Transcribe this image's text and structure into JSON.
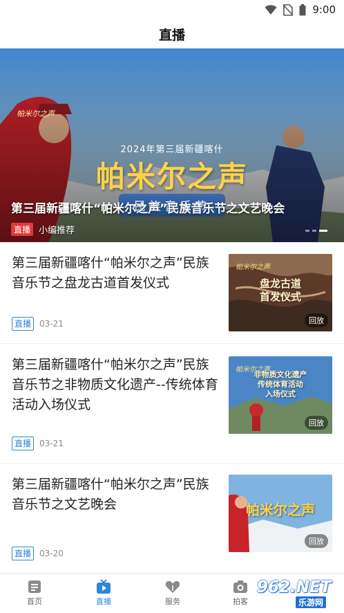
{
  "status_bar": {
    "time": "9:00"
  },
  "header": {
    "title": "直播"
  },
  "banner": {
    "top_line": "2024年第三届新疆喀什",
    "main_title": "帕米尔之声",
    "subtitle": "民族音乐节",
    "title": "第三届新疆喀什“帕米尔之声”民族音乐节之文艺晚会",
    "tag": "直播",
    "recommend": "小编推荐"
  },
  "items": [
    {
      "title": "第三届新疆喀什“帕米尔之声”民族音乐节之盘龙古道首发仪式",
      "tag": "直播",
      "date": "03-21",
      "thumb_title": "盘龙古道\n首发仪式",
      "replay": "回放"
    },
    {
      "title": "第三届新疆喀什“帕米尔之声”民族音乐节之非物质文化遗产--传统体育活动入场仪式",
      "tag": "直播",
      "date": "03-21",
      "thumb_title": "非物质文化遗产\n传统体育活动\n入场仪式",
      "replay": "回放"
    },
    {
      "title": "第三届新疆喀什“帕米尔之声”民族音乐节之文艺晚会",
      "tag": "直播",
      "date": "03-20",
      "thumb_title": "帕米尔之声",
      "replay": "回放"
    }
  ],
  "tabbar": {
    "tabs": [
      {
        "label": "首页",
        "icon": "news-icon",
        "active": false
      },
      {
        "label": "直播",
        "icon": "tv-play-icon",
        "active": true
      },
      {
        "label": "服务",
        "icon": "heart-hands-icon",
        "active": false
      },
      {
        "label": "拍客",
        "icon": "camera-icon",
        "active": false
      }
    ]
  },
  "watermark": {
    "brand": "962.NET",
    "sub": "乐游网"
  },
  "colors": {
    "accent": "#2f86d6",
    "live_red": "#e03a3a",
    "banner_gold": "#ffd24a"
  }
}
